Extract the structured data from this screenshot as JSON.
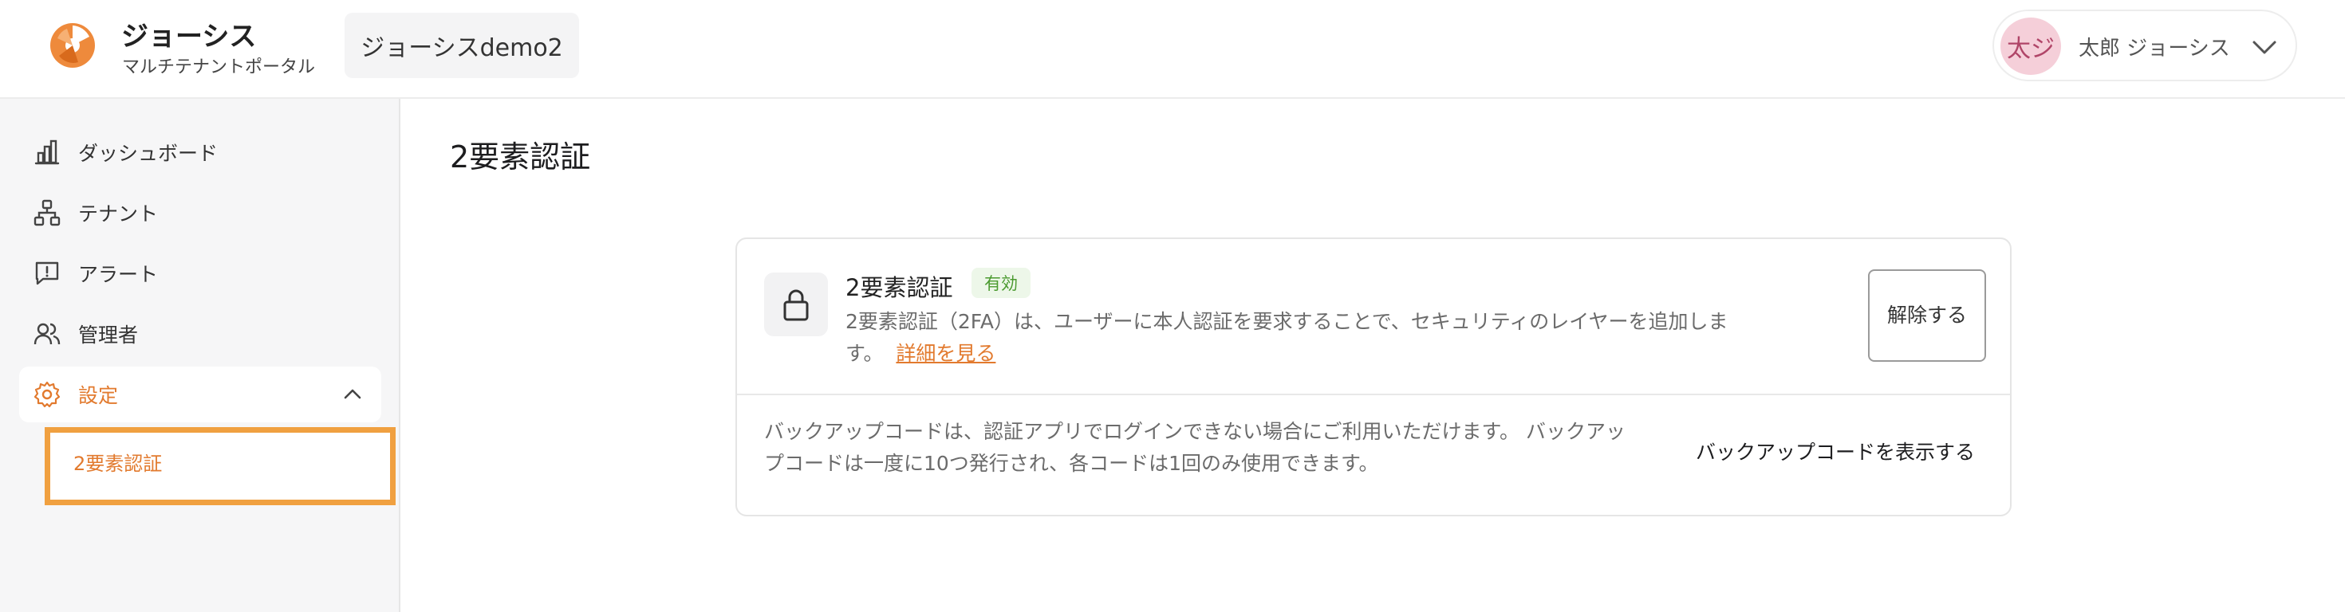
{
  "colors": {
    "accent": "#e27a2e",
    "highlight_border": "#f0a040",
    "badge_bg": "#edf7e9",
    "badge_text": "#4a9a2f",
    "avatar_bg": "#f5cfd9",
    "sidebar_bg": "#f6f6f7"
  },
  "header": {
    "brand_title": "ジョーシス",
    "brand_subtitle": "マルチテナントポータル",
    "tenant_name": "ジョーシスdemo2",
    "user": {
      "avatar_text": "太ジ",
      "name": "太郎 ジョーシス",
      "menu_icon": "chevron-down-icon"
    }
  },
  "sidebar": {
    "items": [
      {
        "label": "ダッシュボード",
        "icon": "bar-chart-icon"
      },
      {
        "label": "テナント",
        "icon": "hierarchy-icon"
      },
      {
        "label": "アラート",
        "icon": "alert-message-icon"
      },
      {
        "label": "管理者",
        "icon": "users-icon"
      },
      {
        "label": "設定",
        "icon": "gear-icon",
        "expanded": true
      }
    ],
    "subitems": [
      {
        "label": "2要素認証",
        "active": true
      }
    ]
  },
  "main": {
    "page_title": "2要素認証",
    "two_factor": {
      "icon": "lock-icon",
      "title": "2要素認証",
      "status_badge": "有効",
      "description": "2要素認証（2FA）は、ユーザーに本人認証を要求することで、セキュリティのレイヤーを追加します。",
      "learn_more": "詳細を見る",
      "disable_button": "解除する"
    },
    "backup": {
      "description": "バックアップコードは、認証アプリでログインできない場合にご利用いただけます。 バックアップコードは一度に10つ発行され、各コードは1回のみ使用できます。",
      "show_button": "バックアップコードを表示する"
    }
  }
}
